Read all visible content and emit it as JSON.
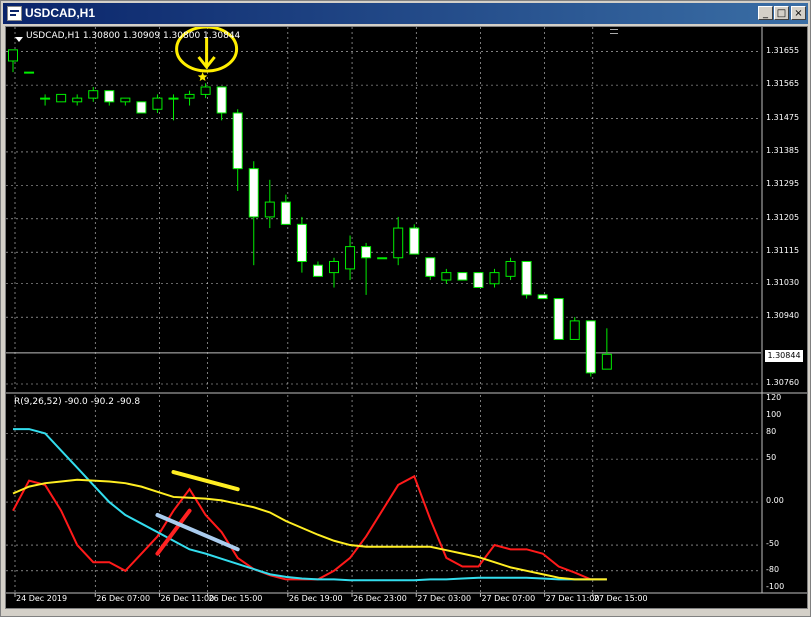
{
  "window": {
    "title": "USDCAD,H1",
    "minimize_glyph": "_",
    "maximize_glyph": "□",
    "close_glyph": "×"
  },
  "chart": {
    "symbol_info": "USDCAD,H1  1.30800 1.30909 1.30800 1.30844",
    "indicator_info": "R(9,26,52) -90.0 -90.2 -90.8",
    "current_price": "1.30844",
    "price_ticks": [
      "1.31655",
      "1.31565",
      "1.31475",
      "1.31385",
      "1.31295",
      "1.31205",
      "1.31115",
      "1.31030",
      "1.30940",
      "1.30760"
    ],
    "indicator_ticks": [
      "120",
      "100",
      "80",
      "50",
      "0.00",
      "-50",
      "-80",
      "-100"
    ],
    "time_ticks": [
      "24 Dec 2019",
      "26 Dec 07:00",
      "26 Dec 11:00",
      "26 Dec 15:00",
      "26 Dec 19:00",
      "26 Dec 23:00",
      "27 Dec 03:00",
      "27 Dec 07:00",
      "27 Dec 11:00",
      "27 Dec 15:00"
    ]
  },
  "chart_data": {
    "type": "candlestick",
    "symbol": "USDCAD",
    "timeframe": "H1",
    "price_axis": {
      "min": 1.3076,
      "max": 1.317
    },
    "candles": [
      {
        "o": 1.3163,
        "h": 1.3166,
        "l": 1.316,
        "c": 1.3166
      },
      {
        "o": 1.316,
        "h": 1.316,
        "l": 1.316,
        "c": 1.316
      },
      {
        "o": 1.3153,
        "h": 1.3154,
        "l": 1.3151,
        "c": 1.3153
      },
      {
        "o": 1.3152,
        "h": 1.3154,
        "l": 1.3152,
        "c": 1.3154
      },
      {
        "o": 1.3152,
        "h": 1.3154,
        "l": 1.3151,
        "c": 1.3153
      },
      {
        "o": 1.3153,
        "h": 1.3156,
        "l": 1.3152,
        "c": 1.3155
      },
      {
        "o": 1.3155,
        "h": 1.3155,
        "l": 1.3151,
        "c": 1.3152
      },
      {
        "o": 1.3152,
        "h": 1.3153,
        "l": 1.3151,
        "c": 1.3153
      },
      {
        "o": 1.3152,
        "h": 1.3152,
        "l": 1.3149,
        "c": 1.3149
      },
      {
        "o": 1.315,
        "h": 1.3154,
        "l": 1.3149,
        "c": 1.3153
      },
      {
        "o": 1.3153,
        "h": 1.3154,
        "l": 1.3147,
        "c": 1.3153
      },
      {
        "o": 1.3153,
        "h": 1.3155,
        "l": 1.3151,
        "c": 1.3154
      },
      {
        "o": 1.3154,
        "h": 1.3157,
        "l": 1.3153,
        "c": 1.3156
      },
      {
        "o": 1.3156,
        "h": 1.3156,
        "l": 1.3147,
        "c": 1.3149
      },
      {
        "o": 1.3149,
        "h": 1.315,
        "l": 1.3128,
        "c": 1.3134
      },
      {
        "o": 1.3134,
        "h": 1.3136,
        "l": 1.3108,
        "c": 1.3121
      },
      {
        "o": 1.3121,
        "h": 1.3131,
        "l": 1.3118,
        "c": 1.3125
      },
      {
        "o": 1.3125,
        "h": 1.3127,
        "l": 1.3119,
        "c": 1.3119
      },
      {
        "o": 1.3119,
        "h": 1.3121,
        "l": 1.3106,
        "c": 1.3109
      },
      {
        "o": 1.3108,
        "h": 1.3109,
        "l": 1.3105,
        "c": 1.3105
      },
      {
        "o": 1.3106,
        "h": 1.311,
        "l": 1.3102,
        "c": 1.3109
      },
      {
        "o": 1.3107,
        "h": 1.3116,
        "l": 1.3104,
        "c": 1.3113
      },
      {
        "o": 1.3113,
        "h": 1.3114,
        "l": 1.31,
        "c": 1.311
      },
      {
        "o": 1.311,
        "h": 1.311,
        "l": 1.311,
        "c": 1.311
      },
      {
        "o": 1.311,
        "h": 1.3121,
        "l": 1.3108,
        "c": 1.3118
      },
      {
        "o": 1.3118,
        "h": 1.3119,
        "l": 1.3111,
        "c": 1.3111
      },
      {
        "o": 1.311,
        "h": 1.311,
        "l": 1.3104,
        "c": 1.3105
      },
      {
        "o": 1.3104,
        "h": 1.3107,
        "l": 1.3103,
        "c": 1.3106
      },
      {
        "o": 1.3106,
        "h": 1.3106,
        "l": 1.3104,
        "c": 1.3104
      },
      {
        "o": 1.3106,
        "h": 1.3106,
        "l": 1.3102,
        "c": 1.3102
      },
      {
        "o": 1.3103,
        "h": 1.3107,
        "l": 1.3102,
        "c": 1.3106
      },
      {
        "o": 1.3105,
        "h": 1.311,
        "l": 1.3104,
        "c": 1.3109
      },
      {
        "o": 1.3109,
        "h": 1.3109,
        "l": 1.3099,
        "c": 1.31
      },
      {
        "o": 1.31,
        "h": 1.31,
        "l": 1.3099,
        "c": 1.3099
      },
      {
        "o": 1.3099,
        "h": 1.3099,
        "l": 1.3088,
        "c": 1.3088
      },
      {
        "o": 1.3088,
        "h": 1.3094,
        "l": 1.3088,
        "c": 1.3093
      },
      {
        "o": 1.3093,
        "h": 1.3093,
        "l": 1.3078,
        "c": 1.3079
      },
      {
        "o": 1.308,
        "h": 1.3091,
        "l": 1.308,
        "c": 1.3084
      }
    ],
    "indicator": {
      "name": "R(9,26,52)",
      "range": [
        -100,
        120
      ],
      "levels": [
        80,
        50,
        0,
        -50,
        -80
      ],
      "series": [
        {
          "name": "red",
          "color": "#ff1a1a",
          "values": [
            -10,
            25,
            20,
            -10,
            -50,
            -70,
            -70,
            -80,
            -60,
            -40,
            -10,
            15,
            -15,
            -35,
            -65,
            -78,
            -85,
            -90,
            -90,
            -90,
            -80,
            -65,
            -40,
            -10,
            20,
            30,
            -20,
            -65,
            -75,
            -75,
            -50,
            -55,
            -55,
            -60,
            -75,
            -82,
            -90,
            -90
          ]
        },
        {
          "name": "cyan",
          "color": "#33ddee",
          "values": [
            85,
            85,
            80,
            60,
            40,
            20,
            0,
            -15,
            -25,
            -35,
            -45,
            -55,
            -60,
            -66,
            -72,
            -78,
            -84,
            -87,
            -89,
            -90,
            -90,
            -91,
            -91,
            -91,
            -91,
            -91,
            -90,
            -90,
            -89,
            -88,
            -88,
            -88,
            -88,
            -89,
            -90,
            -90,
            -90,
            -90
          ]
        },
        {
          "name": "yellow",
          "color": "#ffee22",
          "values": [
            10,
            18,
            22,
            24,
            26,
            25,
            24,
            22,
            18,
            12,
            6,
            5,
            4,
            2,
            -2,
            -6,
            -12,
            -22,
            -30,
            -38,
            -45,
            -50,
            -52,
            -52,
            -52,
            -52,
            -52,
            -56,
            -60,
            -64,
            -70,
            -76,
            -80,
            -84,
            -88,
            -90,
            -90,
            -90
          ]
        }
      ]
    },
    "annotations": [
      {
        "kind": "circle",
        "color": "#ffee00",
        "target_candle": 12,
        "label": ""
      },
      {
        "kind": "arrow-down",
        "color": "#ffee00",
        "target_candle": 12
      },
      {
        "kind": "star",
        "color": "#ffee00",
        "target_candle": 12
      },
      {
        "kind": "line",
        "color": "#ffee22",
        "from": [
          10,
          35
        ],
        "to": [
          14,
          15
        ]
      },
      {
        "kind": "line",
        "color": "#ff2222",
        "from": [
          9,
          -60
        ],
        "to": [
          11,
          -10
        ]
      },
      {
        "kind": "line",
        "color": "#aaccee",
        "from": [
          9,
          -15
        ],
        "to": [
          14,
          -55
        ]
      }
    ],
    "colors": {
      "up_body": "#000000",
      "up_outline": "#00ee00",
      "down_body": "#ffffff",
      "down_outline": "#00ee00",
      "grid": "#ffffff",
      "background": "#000000"
    }
  }
}
